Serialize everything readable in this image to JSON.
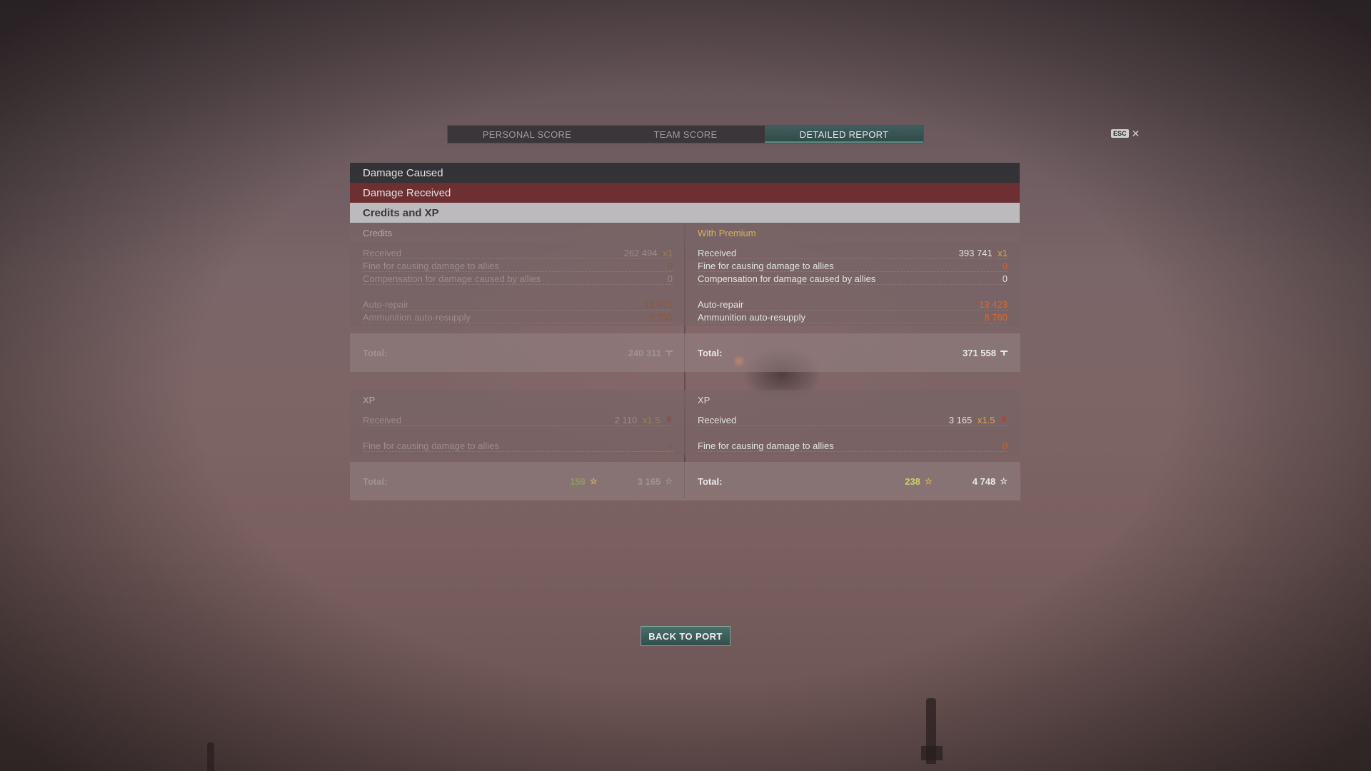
{
  "tabs": [
    {
      "label": "PERSONAL SCORE",
      "active": false
    },
    {
      "label": "TEAM SCORE",
      "active": false
    },
    {
      "label": "DETAILED REPORT",
      "active": true
    }
  ],
  "esc": {
    "key": "ESC",
    "close_icon": "close-icon"
  },
  "sections": {
    "damage_caused": "Damage Caused",
    "damage_received": "Damage Received",
    "credits_xp": "Credits and XP"
  },
  "credits": {
    "left": {
      "title": "Credits",
      "received_label": "Received",
      "received_value": "262 494",
      "received_mult": "x1",
      "fine_label": "Fine for causing damage to allies",
      "fine_value": "0",
      "comp_label": "Compensation for damage caused by allies",
      "comp_value": "0",
      "repair_label": "Auto-repair",
      "repair_value": "13 423",
      "ammo_label": "Ammunition auto-resupply",
      "ammo_value": "8 760",
      "total_label": "Total:",
      "total_value": "240 311",
      "currency_icon": "credits-icon"
    },
    "right": {
      "title": "With Premium",
      "received_label": "Received",
      "received_value": "393 741",
      "received_mult": "x1",
      "fine_label": "Fine for causing damage to allies",
      "fine_value": "0",
      "comp_label": "Compensation for damage caused by allies",
      "comp_value": "0",
      "repair_label": "Auto-repair",
      "repair_value": "13 423",
      "ammo_label": "Ammunition auto-resupply",
      "ammo_value": "8 760",
      "total_label": "Total:",
      "total_value": "371 558",
      "currency_icon": "credits-icon"
    }
  },
  "xp": {
    "left": {
      "title": "XP",
      "received_label": "Received",
      "received_value": "2 110",
      "received_mult": "x1.5",
      "fine_label": "Fine for causing damage to allies",
      "fine_value": "0",
      "total_label": "Total:",
      "total_free": "159",
      "total_xp": "3 165"
    },
    "right": {
      "title": "XP",
      "received_label": "Received",
      "received_value": "3 165",
      "received_mult": "x1.5",
      "fine_label": "Fine for causing damage to allies",
      "fine_value": "0",
      "total_label": "Total:",
      "total_free": "238",
      "total_xp": "4 748"
    }
  },
  "back_button": "BACK TO PORT",
  "colors": {
    "accent_teal": "#3f5f5c",
    "damage_received_red": "#6e2a2c",
    "premium_gold": "#d6b25a",
    "negative_orange": "#e0662a"
  }
}
